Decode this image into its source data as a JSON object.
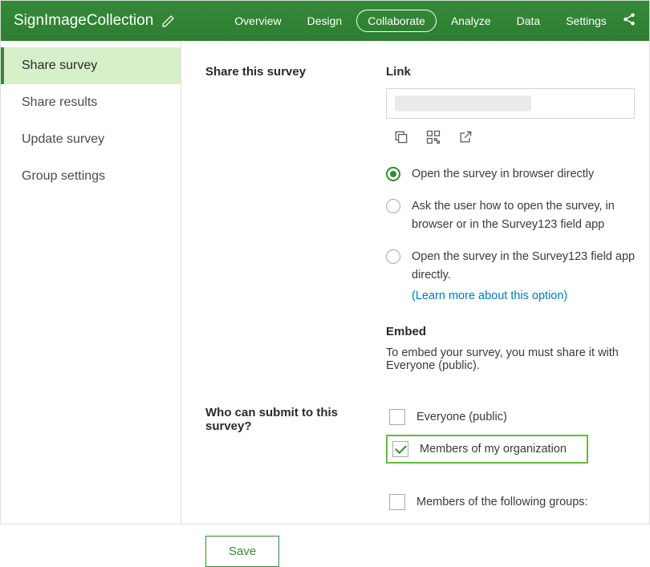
{
  "header": {
    "title": "SignImageCollection",
    "nav": {
      "overview": "Overview",
      "design": "Design",
      "collaborate": "Collaborate",
      "analyze": "Analyze",
      "data": "Data",
      "settings": "Settings"
    }
  },
  "sidebar": {
    "share_survey": "Share survey",
    "share_results": "Share results",
    "update_survey": "Update survey",
    "group_settings": "Group settings"
  },
  "section1": {
    "label": "Share this survey",
    "link_label": "Link",
    "radios": {
      "r1": "Open the survey in browser directly",
      "r2": "Ask the user how to open the survey, in browser or in the Survey123 field app",
      "r3": "Open the survey in the Survey123 field app directly.",
      "learn_more": "(Learn more about this option)"
    },
    "embed_label": "Embed",
    "embed_text": "To embed your survey, you must share it with Everyone (public)."
  },
  "section2": {
    "label": "Who can submit to this survey?",
    "checkbox": {
      "c1": "Everyone (public)",
      "c2": "Members of my organization",
      "c3": "Members of the following groups:"
    }
  },
  "save_label": "Save"
}
